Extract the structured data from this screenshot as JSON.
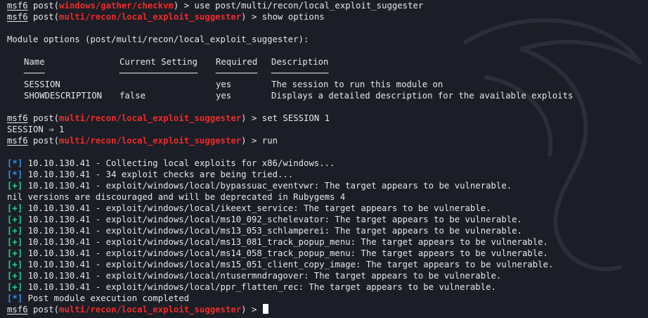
{
  "prompt": {
    "msf": "msf6",
    "post": " post(",
    "close": ")",
    "arrow": " > "
  },
  "lines": {
    "l0": {
      "module": "windows/gather/checkvm",
      "cmd": "use post/multi/recon/local_exploit_suggester"
    },
    "l1": {
      "module": "multi/recon/local_exploit_suggester",
      "cmd": "show options"
    },
    "l3": "Module options (post/multi/recon/local_exploit_suggester):",
    "l10": {
      "module": "multi/recon/local_exploit_suggester",
      "cmd": "set SESSION 1"
    },
    "l11": "SESSION ⇒ 1",
    "l12": {
      "module": "multi/recon/local_exploit_suggester",
      "cmd": "run"
    },
    "l25": {
      "module": "multi/recon/local_exploit_suggester",
      "cmd": ""
    }
  },
  "options_table": {
    "headers": {
      "name": "Name",
      "current": "Current Setting",
      "required": "Required",
      "description": "Description"
    },
    "underlines": {
      "name": "────",
      "current": "───────────────",
      "required": "────────",
      "description": "───────────"
    },
    "rows": [
      {
        "name": "SESSION",
        "current": "",
        "required": "yes",
        "description": "The session to run this module on"
      },
      {
        "name": "SHOWDESCRIPTION",
        "current": "false",
        "required": "yes",
        "description": "Displays a detailed description for the available exploits"
      }
    ]
  },
  "output": [
    {
      "tag": "[*]",
      "color": "blue",
      "text": " 10.10.130.41 - Collecting local exploits for x86/windows..."
    },
    {
      "tag": "[*]",
      "color": "blue",
      "text": " 10.10.130.41 - 34 exploit checks are being tried..."
    },
    {
      "tag": "[+]",
      "color": "green",
      "text": " 10.10.130.41 - exploit/windows/local/bypassuac_eventvwr: The target appears to be vulnerable."
    },
    {
      "tag": "",
      "color": "none",
      "text": "nil versions are discouraged and will be deprecated in Rubygems 4"
    },
    {
      "tag": "[+]",
      "color": "green",
      "text": " 10.10.130.41 - exploit/windows/local/ikeext_service: The target appears to be vulnerable."
    },
    {
      "tag": "[+]",
      "color": "green",
      "text": " 10.10.130.41 - exploit/windows/local/ms10_092_schelevator: The target appears to be vulnerable."
    },
    {
      "tag": "[+]",
      "color": "green",
      "text": " 10.10.130.41 - exploit/windows/local/ms13_053_schlamperei: The target appears to be vulnerable."
    },
    {
      "tag": "[+]",
      "color": "green",
      "text": " 10.10.130.41 - exploit/windows/local/ms13_081_track_popup_menu: The target appears to be vulnerable."
    },
    {
      "tag": "[+]",
      "color": "green",
      "text": " 10.10.130.41 - exploit/windows/local/ms14_058_track_popup_menu: The target appears to be vulnerable."
    },
    {
      "tag": "[+]",
      "color": "green",
      "text": " 10.10.130.41 - exploit/windows/local/ms15_051_client_copy_image: The target appears to be vulnerable."
    },
    {
      "tag": "[+]",
      "color": "green",
      "text": " 10.10.130.41 - exploit/windows/local/ntusermndragover: The target appears to be vulnerable."
    },
    {
      "tag": "[+]",
      "color": "green",
      "text": " 10.10.130.41 - exploit/windows/local/ppr_flatten_rec: The target appears to be vulnerable."
    },
    {
      "tag": "[*]",
      "color": "blue",
      "text": " Post module execution completed"
    }
  ],
  "colors": {
    "background": "#1b1e26",
    "text": "#e6e6e6",
    "module": "#ef2a2a",
    "info": "#3b8eea",
    "good": "#23d18b"
  }
}
